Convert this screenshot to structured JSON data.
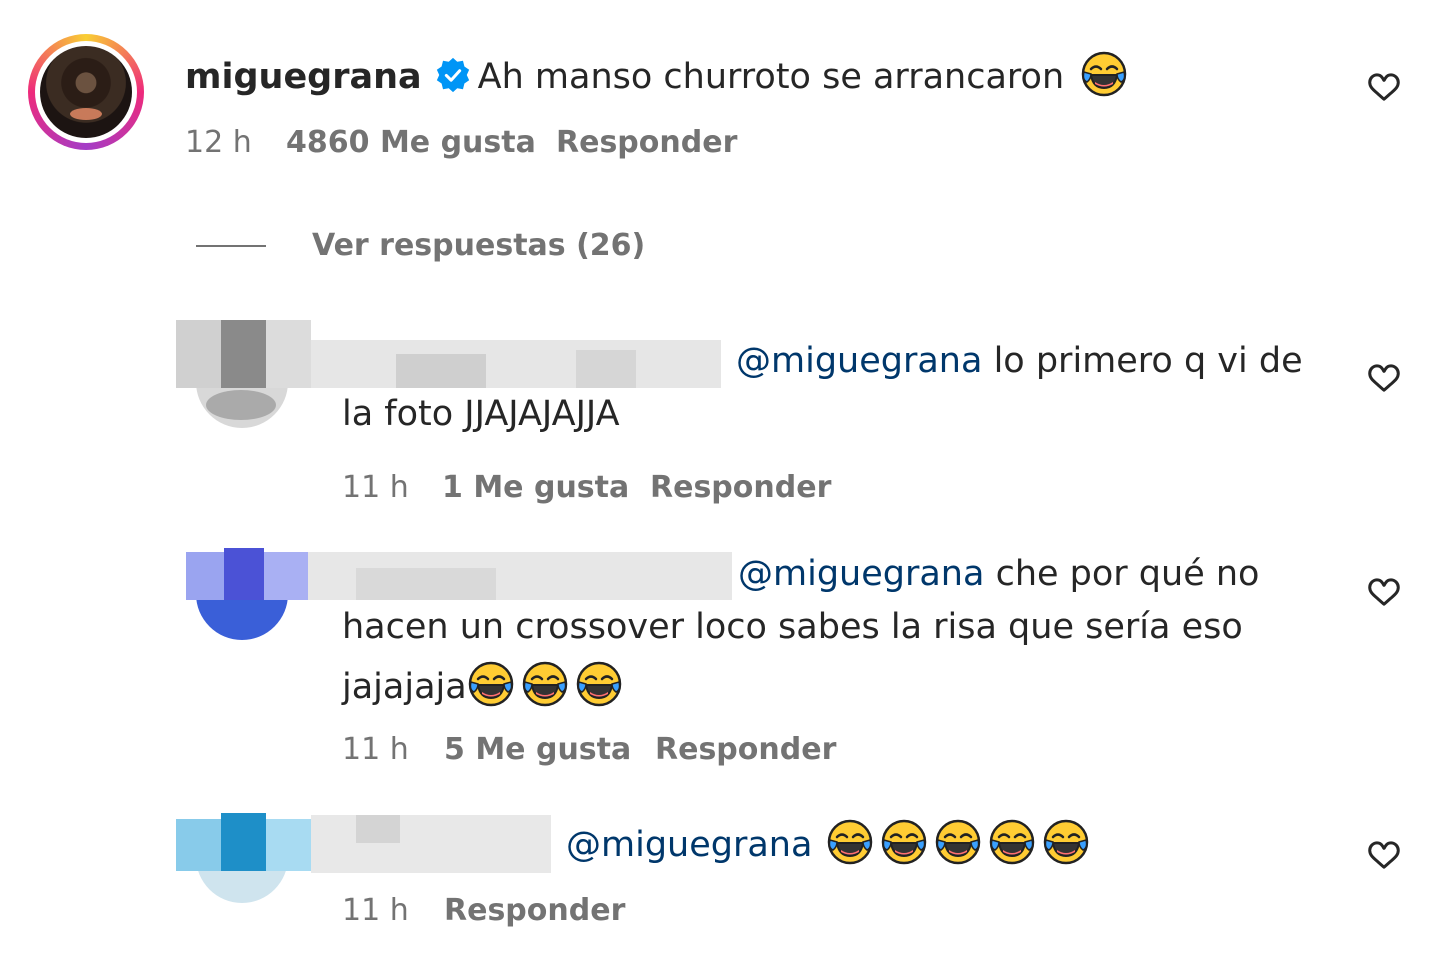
{
  "main_comment": {
    "username": "miguegrana",
    "text": "Ah manso churroto se arrancaron",
    "emoji": "face-with-tears-of-joy",
    "time": "12 h",
    "likes": "4860 Me gusta",
    "reply": "Responder"
  },
  "view_replies": "Ver respuestas (26)",
  "replies": [
    {
      "mention": "@miguegrana",
      "line1": "lo primero q vi de",
      "line2": "la foto JJAJAJAJJA",
      "time": "11 h",
      "likes": "1 Me gusta",
      "reply": "Responder"
    },
    {
      "mention": "@miguegrana",
      "line1": "che por qué no",
      "line2": "hacen un crossover loco sabes la risa que sería eso",
      "line3": "jajajaja",
      "time": "11 h",
      "likes": "5 Me gusta",
      "reply": "Responder"
    },
    {
      "mention": "@miguegrana",
      "time": "11 h",
      "reply": "Responder"
    }
  ],
  "icons": {
    "like": "heart-outline-icon",
    "verified": "verified-badge-icon",
    "emoji": "face-with-tears-of-joy"
  },
  "colors": {
    "text": "#262626",
    "secondary": "#737373",
    "mention": "#00376b",
    "verified": "#0095f6"
  }
}
